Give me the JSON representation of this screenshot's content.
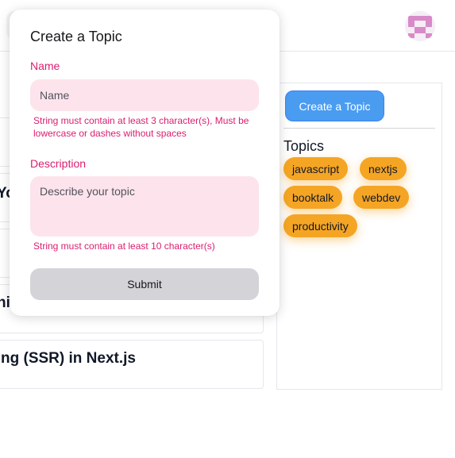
{
  "popover": {
    "title": "Create a Topic",
    "name_label": "Name",
    "name_placeholder": "Name",
    "name_value": "",
    "name_error": "String must contain at least 3 character(s), Must be lowercase or dashes without spaces",
    "description_label": "Description",
    "description_placeholder": "Describe your topic",
    "description_value": "",
    "description_error": "String must contain at least 10 character(s)",
    "submit_label": "Submit"
  },
  "sidebar": {
    "create_button_label": "Create a Topic",
    "topics_heading": "Topics",
    "topics": [
      "javascript",
      "nextjs",
      "booktalk",
      "webdev",
      "productivity"
    ]
  },
  "posts": {
    "fragment_1": "Yo",
    "fragment_2": "hi",
    "fragment_3": "ng (SSR) in Next.js"
  },
  "colors": {
    "accent_primary": "#4a9cf1",
    "chip_warning": "#f5a524",
    "danger_text": "#db1d6f",
    "input_danger_bg": "#fde4ec"
  },
  "icons": {
    "avatar": "identicon-avatar"
  }
}
